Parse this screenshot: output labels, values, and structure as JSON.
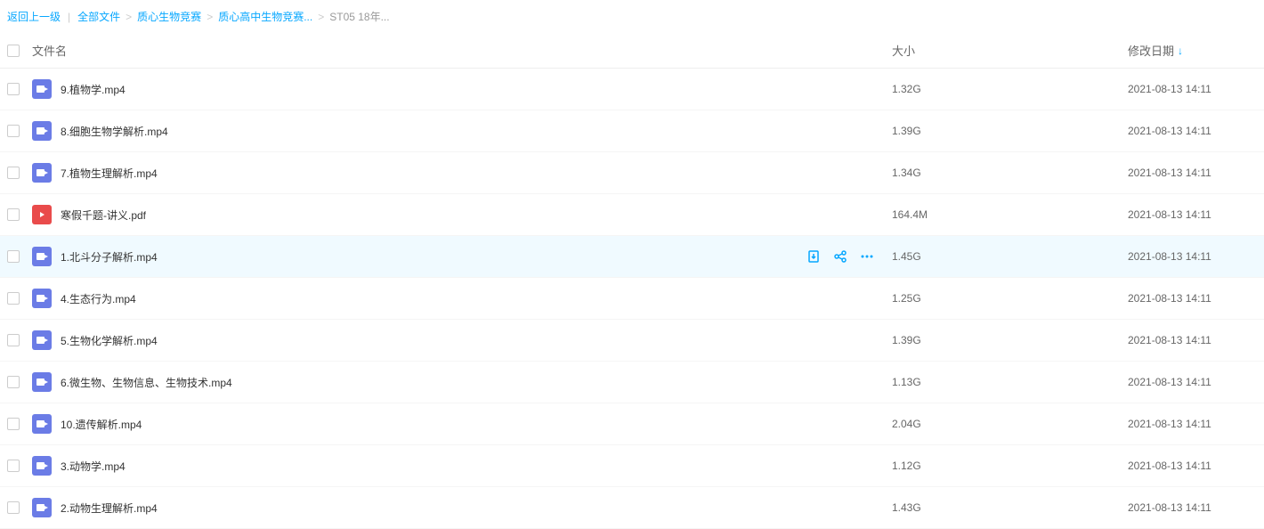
{
  "breadcrumb": {
    "back": "返回上一级",
    "items": [
      {
        "label": "全部文件"
      },
      {
        "label": "质心生物竞赛"
      },
      {
        "label": "质心高中生物竞赛..."
      },
      {
        "label": "ST05 18年..."
      }
    ]
  },
  "columns": {
    "name": "文件名",
    "size": "大小",
    "date": "修改日期"
  },
  "files": [
    {
      "name": "9.植物学.mp4",
      "type": "video",
      "size": "1.32G",
      "date": "2021-08-13 14:11",
      "hovered": false
    },
    {
      "name": "8.细胞生物学解析.mp4",
      "type": "video",
      "size": "1.39G",
      "date": "2021-08-13 14:11",
      "hovered": false
    },
    {
      "name": "7.植物生理解析.mp4",
      "type": "video",
      "size": "1.34G",
      "date": "2021-08-13 14:11",
      "hovered": false
    },
    {
      "name": "寒假千题-讲义.pdf",
      "type": "pdf",
      "size": "164.4M",
      "date": "2021-08-13 14:11",
      "hovered": false
    },
    {
      "name": "1.北斗分子解析.mp4",
      "type": "video",
      "size": "1.45G",
      "date": "2021-08-13 14:11",
      "hovered": true
    },
    {
      "name": "4.生态行为.mp4",
      "type": "video",
      "size": "1.25G",
      "date": "2021-08-13 14:11",
      "hovered": false
    },
    {
      "name": "5.生物化学解析.mp4",
      "type": "video",
      "size": "1.39G",
      "date": "2021-08-13 14:11",
      "hovered": false
    },
    {
      "name": "6.微生物、生物信息、生物技术.mp4",
      "type": "video",
      "size": "1.13G",
      "date": "2021-08-13 14:11",
      "hovered": false
    },
    {
      "name": "10.遗传解析.mp4",
      "type": "video",
      "size": "2.04G",
      "date": "2021-08-13 14:11",
      "hovered": false
    },
    {
      "name": "3.动物学.mp4",
      "type": "video",
      "size": "1.12G",
      "date": "2021-08-13 14:11",
      "hovered": false
    },
    {
      "name": "2.动物生理解析.mp4",
      "type": "video",
      "size": "1.43G",
      "date": "2021-08-13 14:11",
      "hovered": false
    }
  ]
}
